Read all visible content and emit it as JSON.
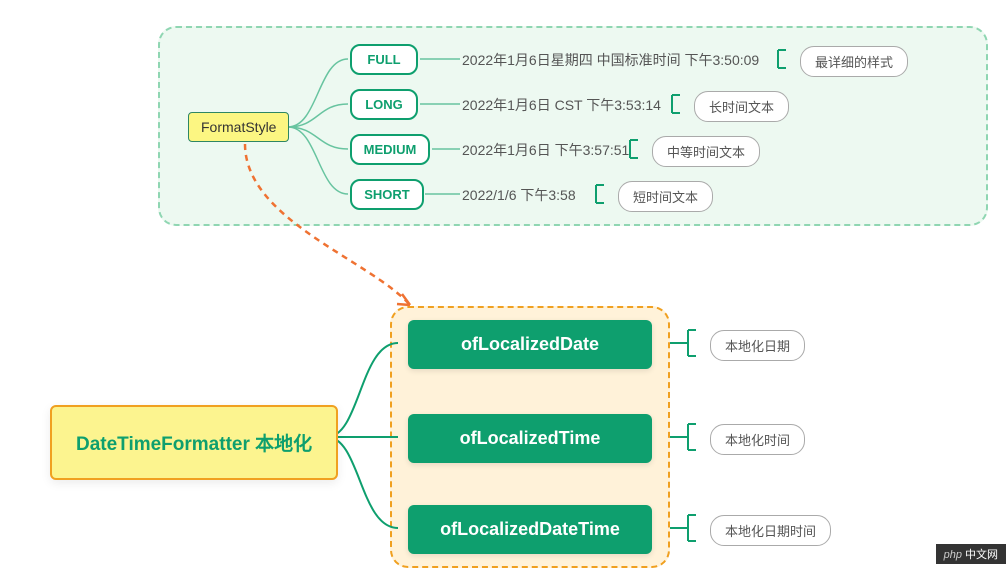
{
  "domain": "Diagram",
  "top_group": {
    "node_label": "FormatStyle",
    "entries": [
      {
        "enum": "FULL",
        "example": "2022年1月6日星期四 中国标准时间 下午3:50:09",
        "caption": "最详细的样式"
      },
      {
        "enum": "LONG",
        "example": "2022年1月6日 CST 下午3:53:14",
        "caption": "长时间文本"
      },
      {
        "enum": "MEDIUM",
        "example": "2022年1月6日 下午3:57:51",
        "caption": "中等时间文本"
      },
      {
        "enum": "SHORT",
        "example": "2022/1/6 下午3:58",
        "caption": "短时间文本"
      }
    ]
  },
  "bottom_group": {
    "root_label": "DateTimeFormatter 本地化",
    "methods": [
      {
        "name": "ofLocalizedDate",
        "caption": "本地化日期"
      },
      {
        "name": "ofLocalizedTime",
        "caption": "本地化时间"
      },
      {
        "name": "ofLocalizedDateTime",
        "caption": "本地化日期时间"
      }
    ]
  },
  "watermark": {
    "left": "php",
    "right": "中文网"
  }
}
